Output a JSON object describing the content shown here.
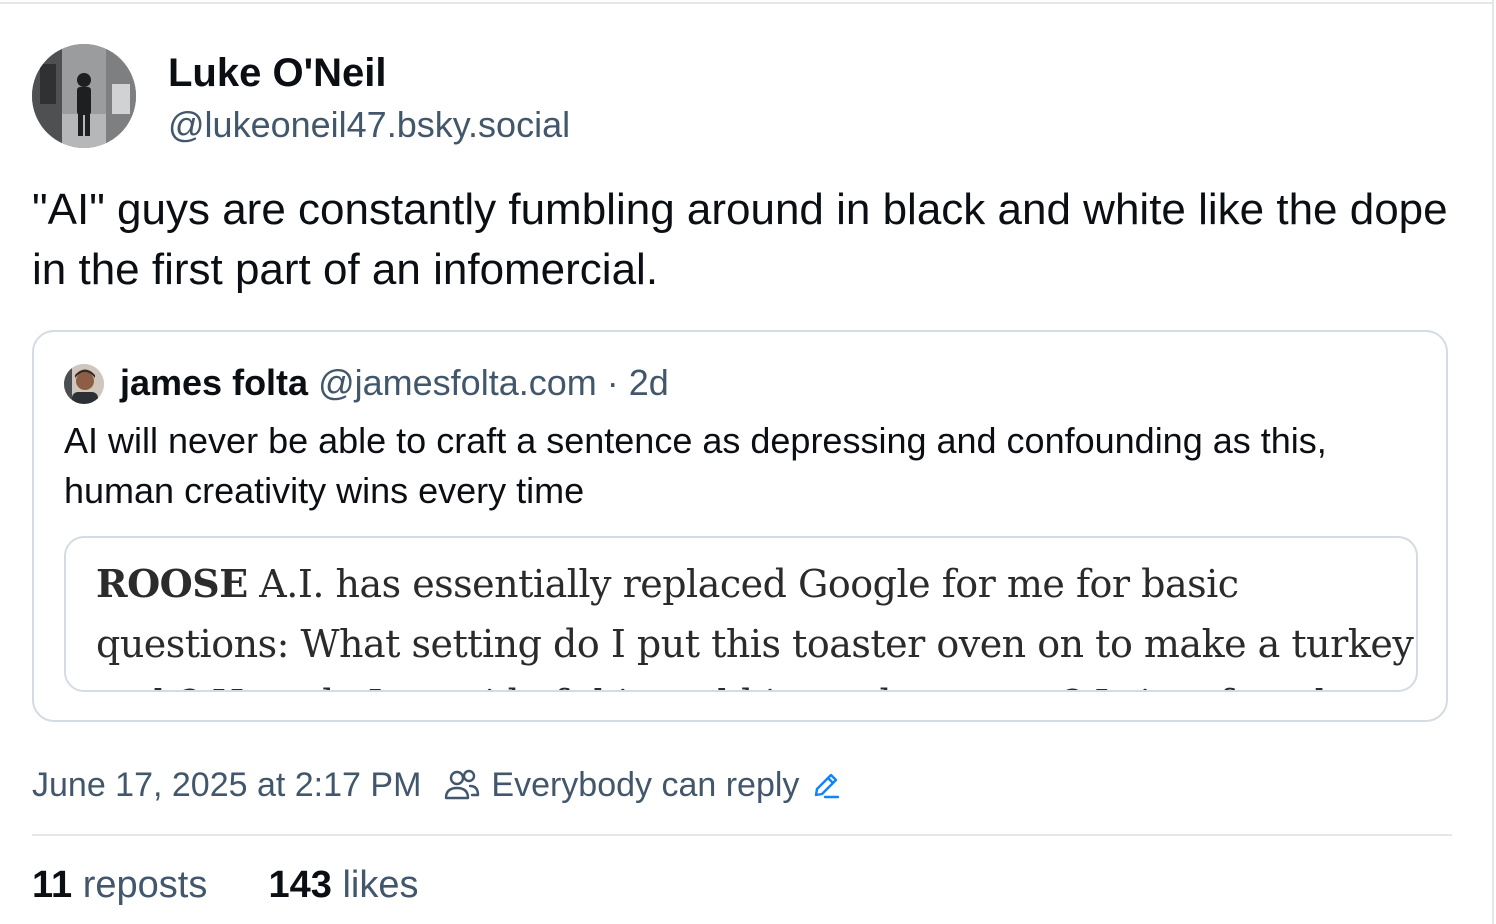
{
  "post": {
    "author": {
      "display_name": "Luke O'Neil",
      "handle": "@lukeoneil47.bsky.social"
    },
    "text": "\"AI\" guys are constantly fumbling around in black and white like the dope in the first part of an infomercial.",
    "quote": {
      "author_name": "james folta",
      "author_handle": "@jamesfolta.com",
      "separator": "·",
      "time": "2d",
      "text": "AI will never be able to craft a sentence as depressing and confounding as this, human creativity wins every time",
      "image": {
        "kicker": "ROOSE",
        "text": "A.I. has essentially replaced Google for me for basic questions: What setting do I put this toaster oven on to make a turkey melt? How do I get rid of this mold in my basement? Is it safe to have a"
      }
    },
    "timestamp": "June 17, 2025 at 2:17 PM",
    "reply_setting": "Everybody can reply",
    "stats": {
      "reposts_count": "11",
      "reposts_label": "reposts",
      "likes_count": "143",
      "likes_label": "likes"
    }
  },
  "colors": {
    "text_primary": "#0b0f14",
    "text_secondary": "#42576c",
    "border": "#d4dbe2",
    "accent": "#1083fe"
  },
  "icons": {
    "reply_setting": "people-icon",
    "edit": "pencil-icon"
  }
}
